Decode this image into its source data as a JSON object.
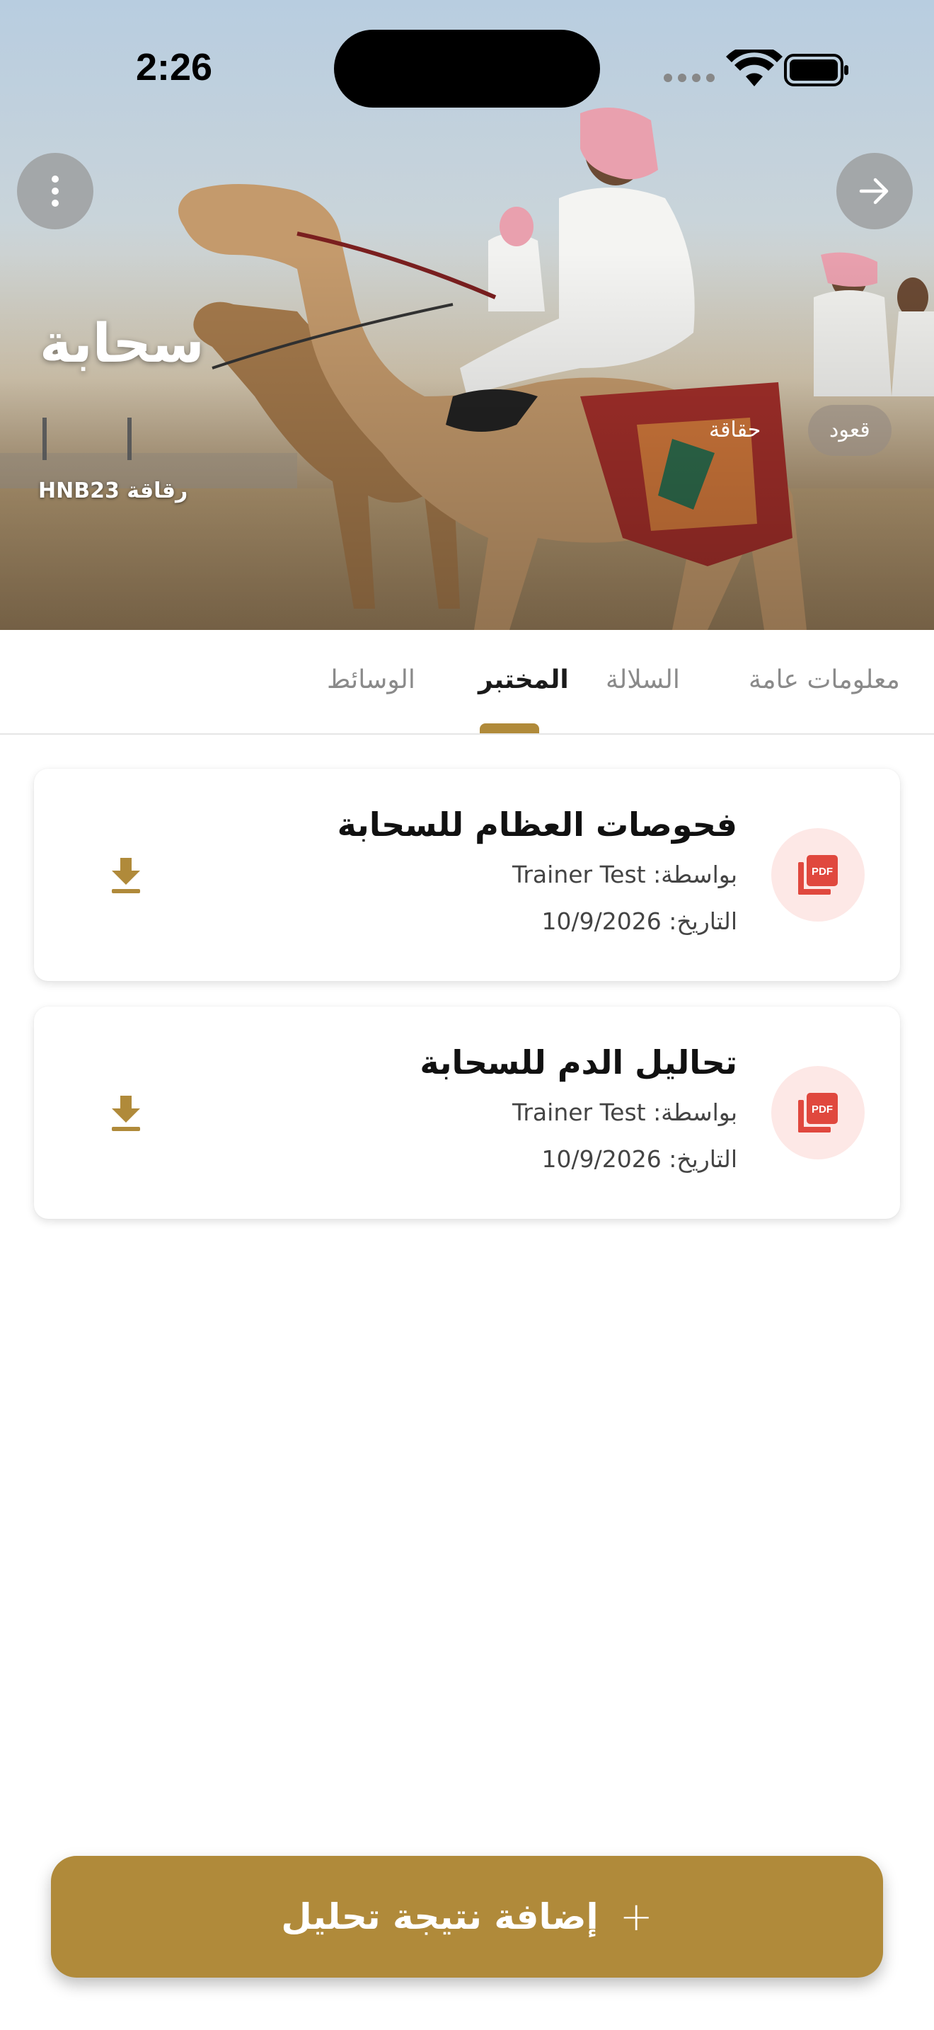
{
  "status_bar": {
    "time": "2:26"
  },
  "hero": {
    "name": "سحابة",
    "code": "رقاقة HNB23",
    "chips": [
      "قعود",
      "حقاقة"
    ]
  },
  "tabs": [
    {
      "label": "معلومات عامة",
      "active": false
    },
    {
      "label": "السلالة",
      "active": false
    },
    {
      "label": "المختبر",
      "active": true
    },
    {
      "label": "الوسائط",
      "active": false
    }
  ],
  "lab_results": [
    {
      "title": "فحوصات العظام للسحابة",
      "by": "بواسطة: Trainer Test",
      "date": "التاريخ: 10/9/2026",
      "icon": "pdf-icon"
    },
    {
      "title": "تحاليل الدم للسحابة",
      "by": "بواسطة: Trainer Test",
      "date": "التاريخ: 10/9/2026",
      "icon": "pdf-icon"
    }
  ],
  "add_button": {
    "label": "إضافة نتيجة تحليل",
    "icon": "plus-icon"
  },
  "colors": {
    "accent": "#b08a3a",
    "pdf_red": "#e0483e",
    "pdf_bg": "#fde8e6"
  }
}
